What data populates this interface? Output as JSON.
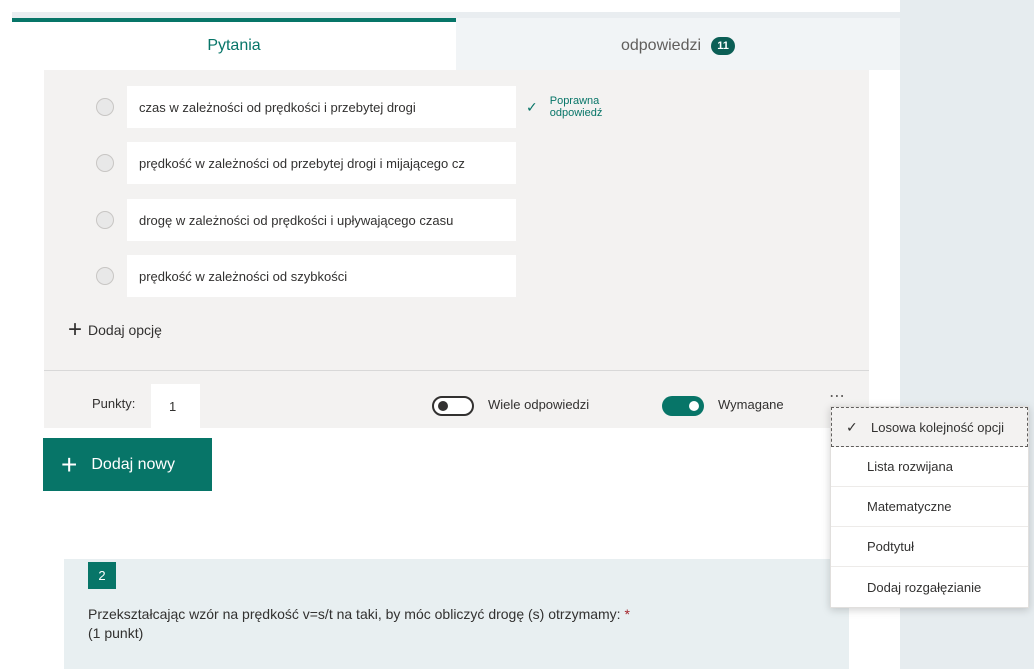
{
  "tabs": {
    "questions_label": "Pytania",
    "responses_label": "odpowiedzi",
    "responses_count": "11"
  },
  "question1": {
    "options": [
      "czas w zależności od prędkości i przebytej drogi",
      "prędkość w zależności od przebytej drogi i mijającego cz",
      "drogę w zależności od prędkości i upływającego czasu",
      "prędkość w zależności od szybkości"
    ],
    "correct_answer_label": "Poprawna odpowiedź",
    "add_option_label": "Dodaj opcję",
    "points_label": "Punkty:",
    "points_value": "1",
    "multiple_answers_label": "Wiele odpowiedzi",
    "required_label": "Wymagane",
    "more_icon": "⋯"
  },
  "add_new_label": "Dodaj nowy",
  "menu": {
    "items": [
      "Losowa kolejność opcji",
      "Lista rozwijana",
      "Matematyczne",
      "Podtytuł",
      "Dodaj rozgałęzianie"
    ]
  },
  "question2": {
    "number": "2",
    "text": "Przekształcając wzór na prędkość v=s/t na taki, by móc obliczyć drogę (s) otrzymamy:",
    "required_mark": "*",
    "points": "(1 punkt)"
  },
  "colors": {
    "accent": "#077568"
  }
}
